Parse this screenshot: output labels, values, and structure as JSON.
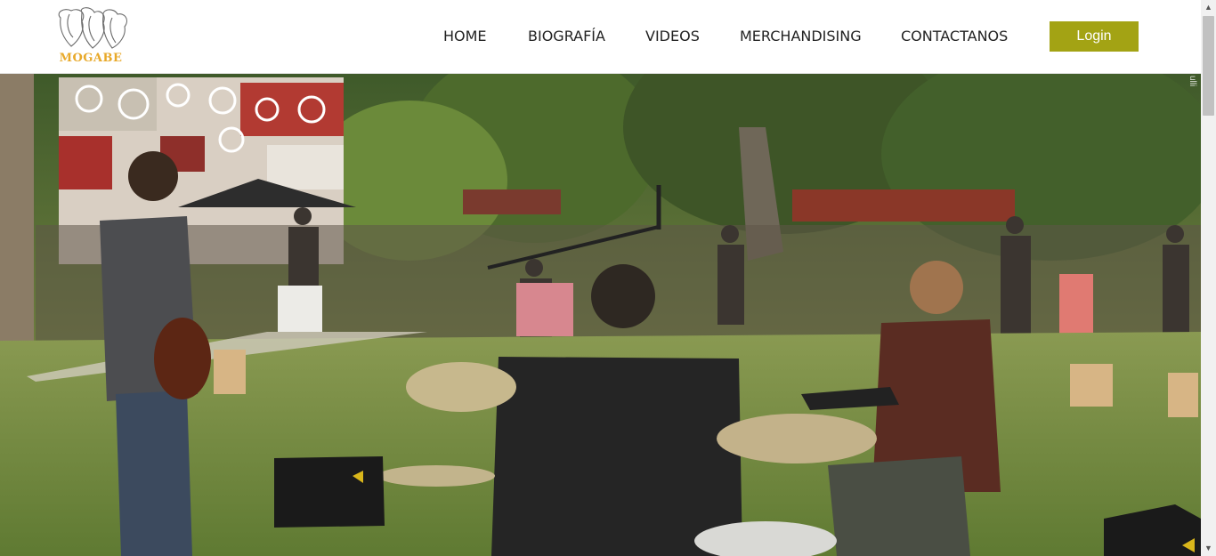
{
  "brand": {
    "name": "MOGABE",
    "logo_icon": "elephants-logo-icon",
    "color": "#e8a92a"
  },
  "nav": {
    "items": [
      {
        "label": "HOME"
      },
      {
        "label": "BIOGRAFÍA"
      },
      {
        "label": "VIDEOS"
      },
      {
        "label": "MERCHANDISING"
      },
      {
        "label": "CONTACTANOS"
      }
    ],
    "login_label": "Login",
    "login_color": "#a3a314"
  },
  "hero": {
    "alt": "Band performing outdoors in a park with audience",
    "credit": "ulli"
  },
  "scrollbar": {
    "up_icon": "scroll-up-icon",
    "down_icon": "scroll-down-icon"
  }
}
